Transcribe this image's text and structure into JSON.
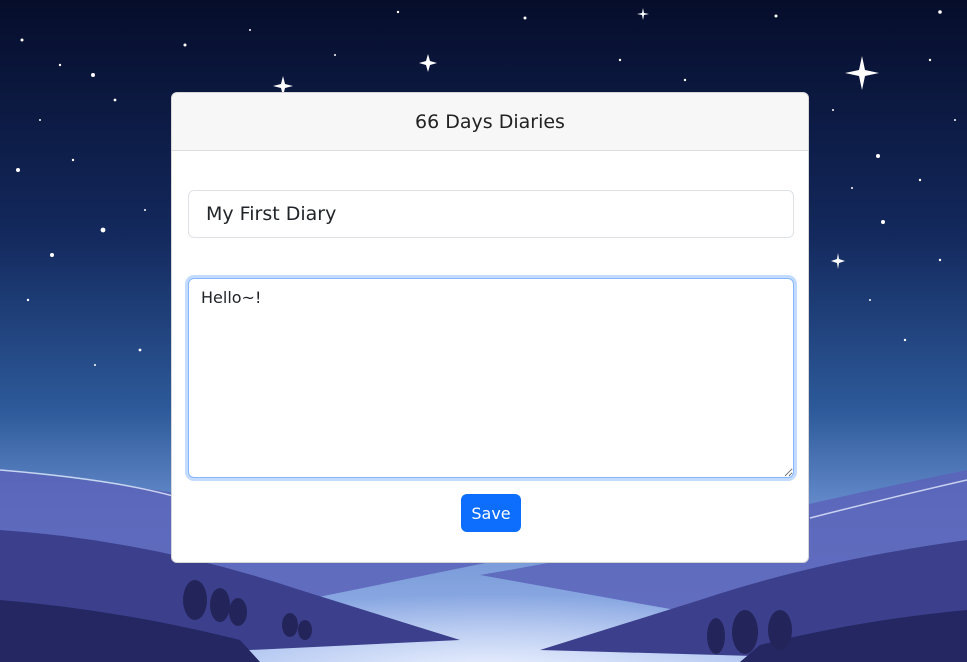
{
  "header": {
    "title": "66 Days Diaries"
  },
  "diary": {
    "title_value": "My First Diary",
    "body_value": "Hello~!"
  },
  "actions": {
    "save_label": "Save"
  },
  "colors": {
    "primary": "#0d6efd",
    "sky_top": "#07102e",
    "sky_mid": "#1d3a78",
    "hills": "#5055a8"
  }
}
